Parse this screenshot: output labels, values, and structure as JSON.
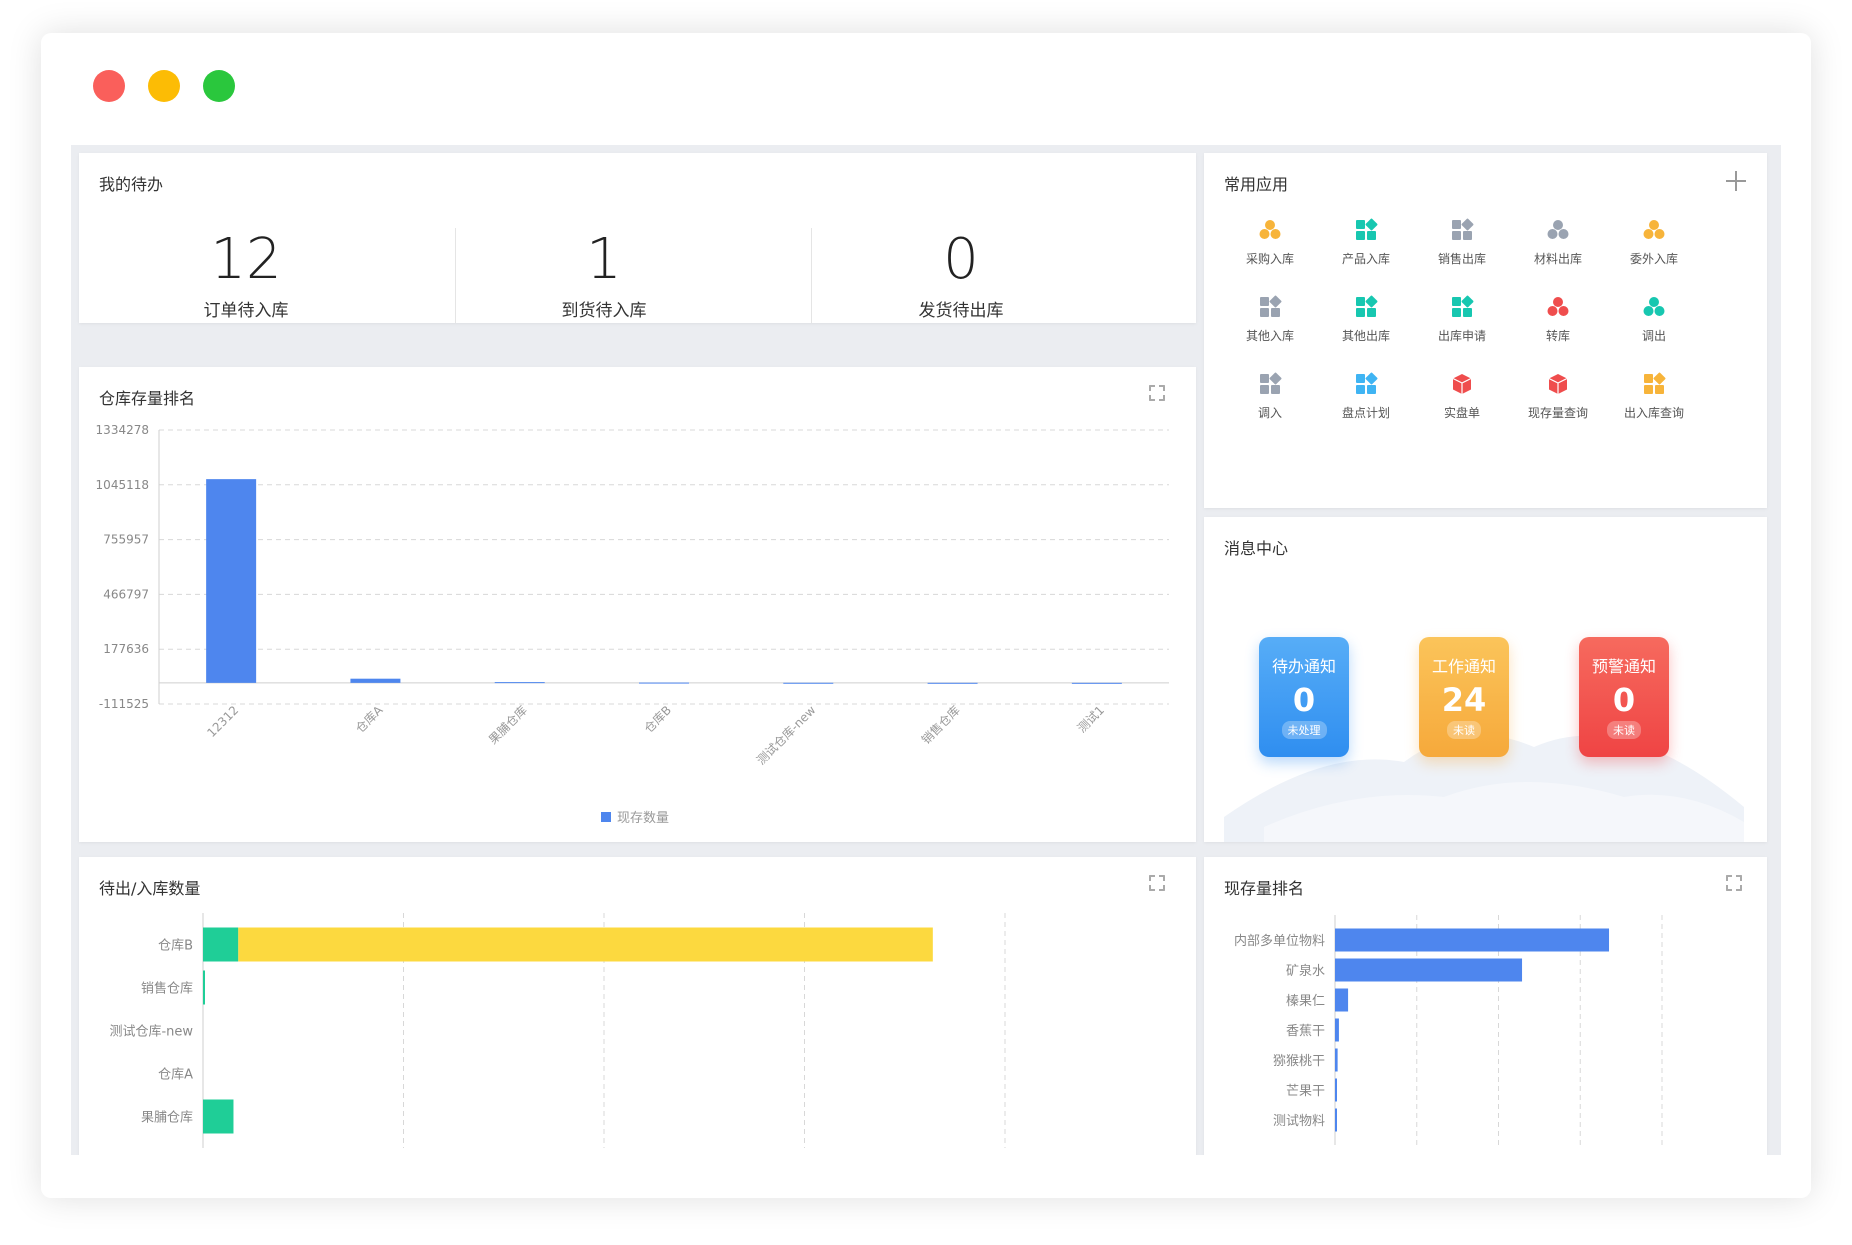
{
  "window": {
    "dots": [
      "#fa5f5b",
      "#fcbc05",
      "#2ac73d"
    ]
  },
  "todo": {
    "title": "我的待办",
    "items": [
      {
        "value": "12",
        "label": "订单待入库"
      },
      {
        "value": "1",
        "label": "到货待入库"
      },
      {
        "value": "0",
        "label": "发货待出库"
      }
    ]
  },
  "apps": {
    "title": "常用应用",
    "add_icon": "plus-icon",
    "items": [
      {
        "label": "采购入库",
        "icon": "cluster",
        "color": "#f7b43a"
      },
      {
        "label": "产品入库",
        "icon": "grid",
        "color": "#17c7b0"
      },
      {
        "label": "销售出库",
        "icon": "grid",
        "color": "#9aa3b1"
      },
      {
        "label": "材料出库",
        "icon": "cluster",
        "color": "#9aa3b1"
      },
      {
        "label": "委外入库",
        "icon": "cluster",
        "color": "#f7b43a"
      },
      {
        "label": "其他入库",
        "icon": "grid",
        "color": "#9aa3b1"
      },
      {
        "label": "其他出库",
        "icon": "grid",
        "color": "#17c7b0"
      },
      {
        "label": "出库申请",
        "icon": "grid",
        "color": "#17c7b0"
      },
      {
        "label": "转库",
        "icon": "cluster",
        "color": "#ef4d4d"
      },
      {
        "label": "调出",
        "icon": "cluster",
        "color": "#17c7b0"
      },
      {
        "label": "调入",
        "icon": "grid",
        "color": "#9aa3b1"
      },
      {
        "label": "盘点计划",
        "icon": "grid",
        "color": "#3fb4f3"
      },
      {
        "label": "实盘单",
        "icon": "box",
        "color": "#ef4d4d"
      },
      {
        "label": "现存量查询",
        "icon": "box",
        "color": "#ef4d4d"
      },
      {
        "label": "出入库查询",
        "icon": "grid",
        "color": "#f7b43a"
      }
    ]
  },
  "messages": {
    "title": "消息中心",
    "cards": [
      {
        "title": "待办通知",
        "count": "0",
        "badge": "未处理",
        "color": "#2f8ef0",
        "color2": "#57adf7"
      },
      {
        "title": "工作通知",
        "count": "24",
        "badge": "未读",
        "color": "#f6a93b",
        "color2": "#fbc45a"
      },
      {
        "title": "预警通知",
        "count": "0",
        "badge": "未读",
        "color": "#ef4444",
        "color2": "#f66a5e"
      }
    ]
  },
  "warehouse_rank": {
    "title": "仓库存量排名",
    "chart_data": {
      "type": "bar",
      "categories": [
        "12312",
        "仓库A",
        "果脯仓库",
        "仓库B",
        "测试仓库-new",
        "销售仓库",
        "测试1"
      ],
      "series": [
        {
          "name": "现存数量",
          "values": [
            1075000,
            22000,
            4000,
            1500,
            500,
            300,
            200
          ]
        }
      ],
      "y_ticks": [
        "1334278",
        "1045118",
        "755957",
        "466797",
        "177636",
        "-111525"
      ],
      "ylim": [
        -111525,
        1334278
      ],
      "grid": true,
      "legend": "bottom",
      "color": "#4e86ee"
    }
  },
  "inout_qty": {
    "title": "待出/入库数量",
    "chart_data": {
      "type": "bar",
      "orientation": "horizontal",
      "categories": [
        "仓库B",
        "销售仓库",
        "测试仓库-new",
        "仓库A",
        "果脯仓库"
      ],
      "series": [
        {
          "values": [
            22,
            0.5,
            0,
            0,
            19
          ],
          "color": "#1fce97"
        },
        {
          "values": [
            433,
            0,
            0,
            0,
            0
          ],
          "color": "#fcd93f"
        }
      ],
      "xlim": [
        0,
        500
      ],
      "grid": true
    }
  },
  "stock_rank": {
    "title": "现存量排名",
    "chart_data": {
      "type": "bar",
      "orientation": "horizontal",
      "categories": [
        "内部多单位物料",
        "矿泉水",
        "榛果仁",
        "香蕉干",
        "猕猴桃干",
        "芒果干",
        "测试物料"
      ],
      "series": [
        {
          "values": [
            4190,
            2860,
            200,
            60,
            40,
            30,
            20
          ],
          "color": "#4e86ee"
        }
      ],
      "xlim": [
        0,
        5000
      ],
      "grid": true
    }
  }
}
